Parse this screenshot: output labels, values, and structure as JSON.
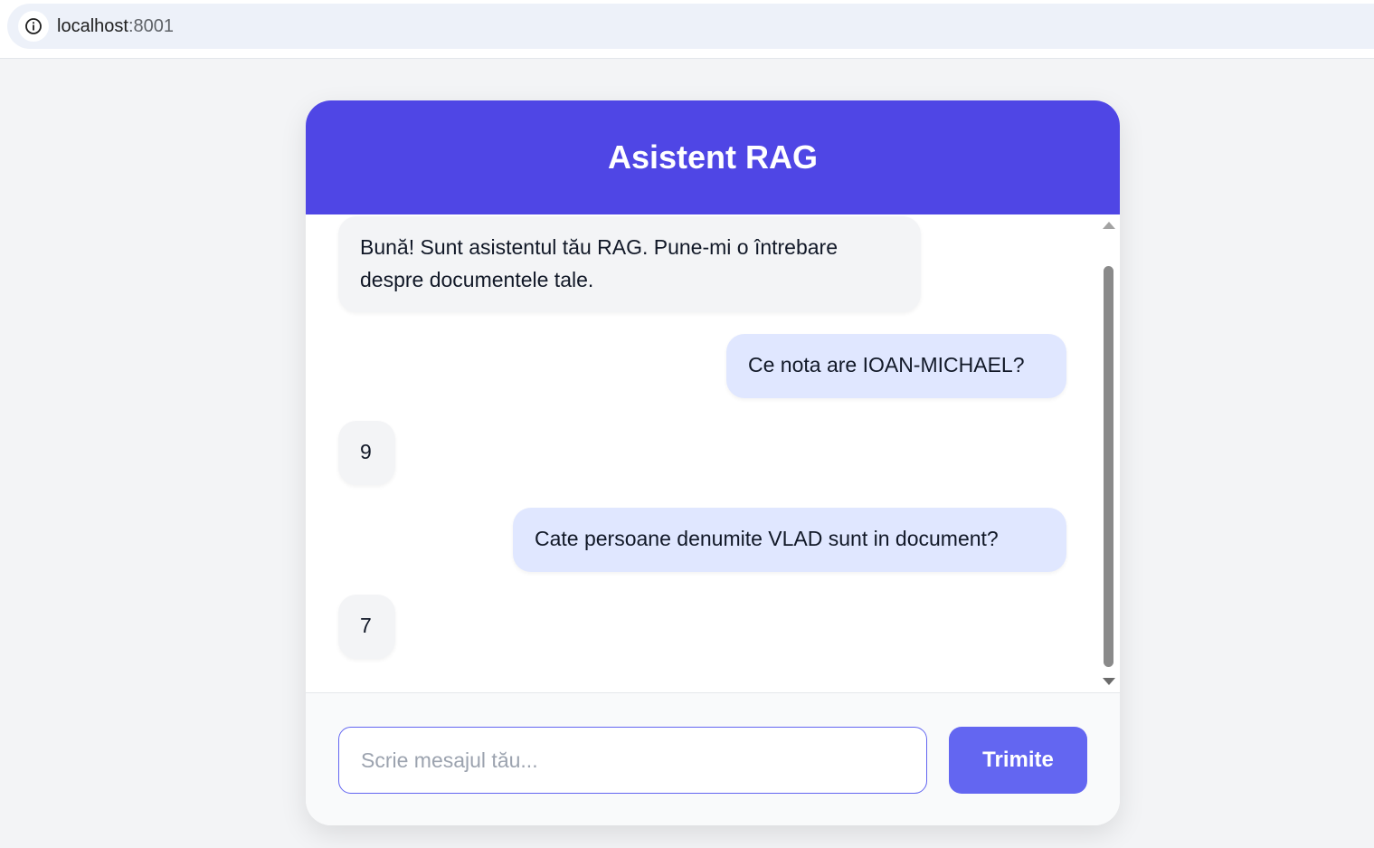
{
  "browser": {
    "url_host": "localhost",
    "url_port": ":8001",
    "info_icon": "info-icon"
  },
  "chat": {
    "title": "Asistent RAG",
    "messages": [
      {
        "role": "bot",
        "text": "Bună! Sunt asistentul tău RAG. Pune-mi o întrebare despre documentele tale."
      },
      {
        "role": "user",
        "text": "Ce nota are IOAN-MICHAEL?"
      },
      {
        "role": "bot",
        "text": "9"
      },
      {
        "role": "user",
        "text": "Cate persoane denumite VLAD sunt in document?"
      },
      {
        "role": "bot",
        "text": "7"
      }
    ],
    "input_placeholder": "Scrie mesajul tău...",
    "input_value": "",
    "send_label": "Trimite"
  },
  "colors": {
    "header": "#4f46e5",
    "send_button": "#6366f1",
    "user_bubble": "#e0e7ff",
    "bot_bubble": "#f3f4f6"
  }
}
